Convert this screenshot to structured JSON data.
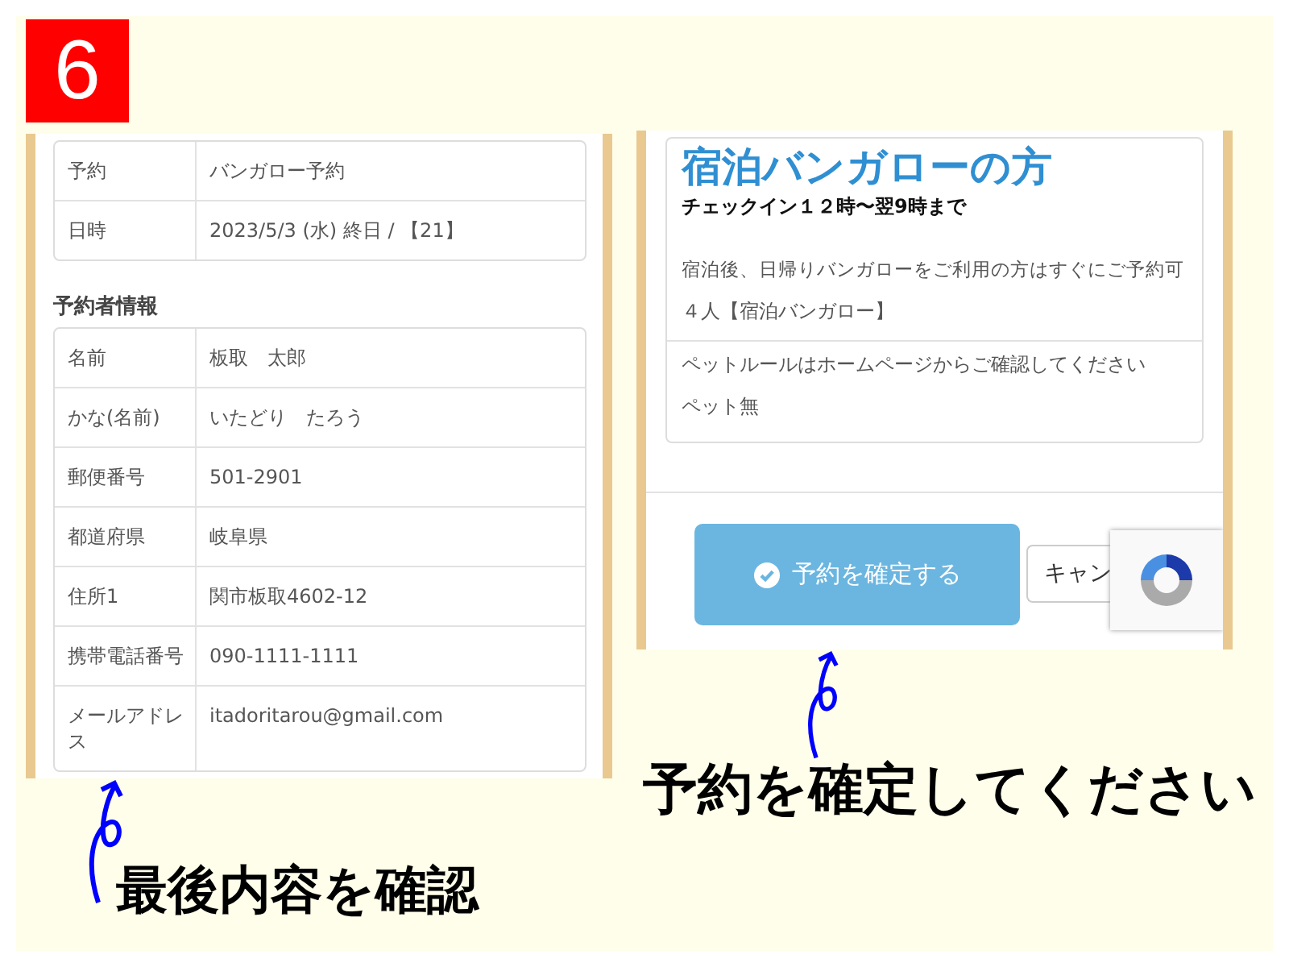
{
  "badge": "6",
  "left_screen": {
    "reservation_rows": [
      {
        "label": "予約",
        "value": "バンガロー予約"
      },
      {
        "label": "日時",
        "value": "2023/5/3 (水) 終日 / 【21】"
      }
    ],
    "section_title": "予約者情報",
    "info_rows": [
      {
        "label": "名前",
        "value": "板取　太郎"
      },
      {
        "label": "かな(名前)",
        "value": "いたどり　たろう"
      },
      {
        "label": "郵便番号",
        "value": "501-2901"
      },
      {
        "label": "都道府県",
        "value": "岐阜県"
      },
      {
        "label": "住所1",
        "value": "関市板取4602-12"
      },
      {
        "label": "携帯電話番号",
        "value": "090-1111-1111"
      },
      {
        "label": "メールアドレス",
        "value": "itadoritarou@gmail.com"
      }
    ]
  },
  "left_caption": "最後内容を確認",
  "right_screen": {
    "plan_title": "宿泊バンガローの方",
    "checkin": "チェックイン１２時〜翌9時まで",
    "note": "宿泊後、日帰りバンガローをご利用の方はすぐにご予約可",
    "guests": "４人【宿泊バンガロー】",
    "pet_rule": "ペットルールはホームページからご確認してください",
    "pet": "ペット無",
    "confirm_button": "予約を確定する",
    "cancel_button": "キャン"
  },
  "right_caption": "予約を確定してください"
}
